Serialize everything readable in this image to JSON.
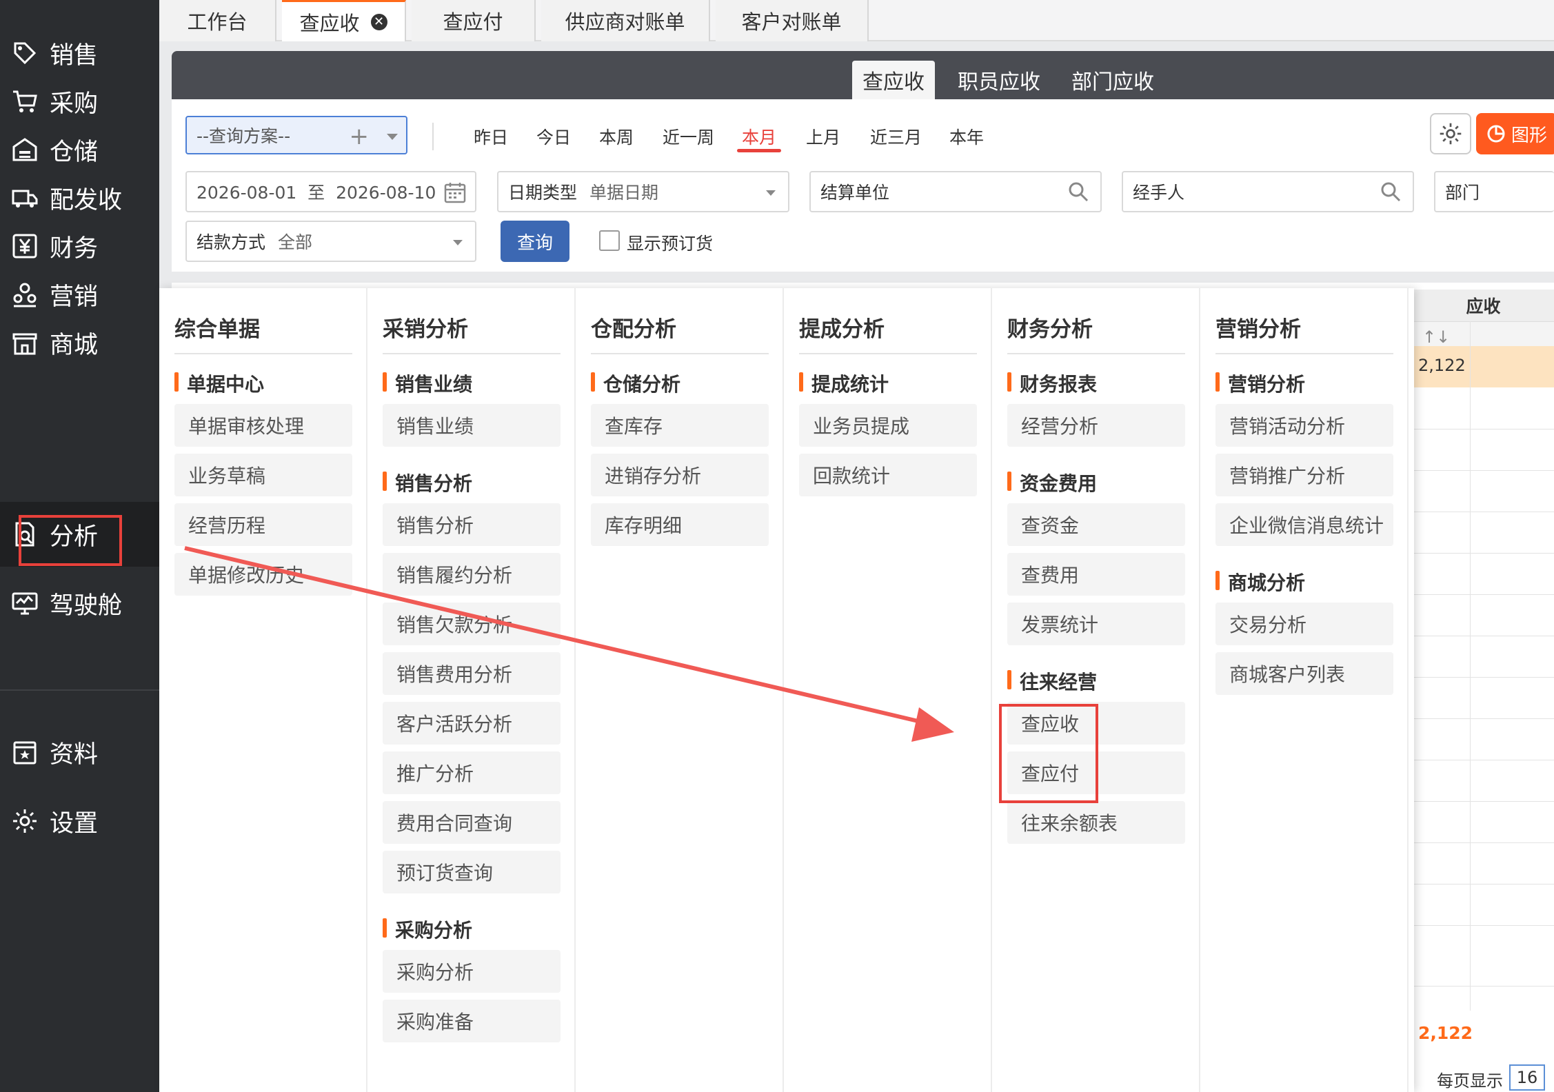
{
  "sidebar": {
    "items": [
      {
        "label": "销售",
        "icon": "tag-icon"
      },
      {
        "label": "采购",
        "icon": "cart-icon"
      },
      {
        "label": "仓储",
        "icon": "warehouse-icon"
      },
      {
        "label": "配发收",
        "icon": "truck-icon"
      },
      {
        "label": "财务",
        "icon": "yen-icon"
      },
      {
        "label": "营销",
        "icon": "people-icon"
      },
      {
        "label": "商城",
        "icon": "store-icon"
      },
      {
        "label": "分析",
        "icon": "analysis-icon"
      },
      {
        "label": "驾驶舱",
        "icon": "monitor-icon"
      },
      {
        "label": "资料",
        "icon": "book-icon"
      },
      {
        "label": "设置",
        "icon": "gear-icon"
      }
    ]
  },
  "tabs": [
    {
      "label": "工作台"
    },
    {
      "label": "查应收",
      "close": "✕"
    },
    {
      "label": "查应付"
    },
    {
      "label": "供应商对账单"
    },
    {
      "label": "客户对账单"
    }
  ],
  "subtabs": [
    {
      "label": "查应收"
    },
    {
      "label": "职员应收"
    },
    {
      "label": "部门应收"
    }
  ],
  "filter": {
    "plan": "--查询方案--",
    "plus": "+",
    "quick_dates": [
      "昨日",
      "今日",
      "本周",
      "近一周",
      "本月",
      "上月",
      "近三月",
      "本年"
    ],
    "chart_label": "图形",
    "date_range": "2026-08-01  至  2026-08-10",
    "date_type_label": "日期类型",
    "date_type_value": "单据日期",
    "settle_unit": "结算单位",
    "handler": "经手人",
    "dept": "部门",
    "pay_method_label": "结款方式",
    "pay_method_value": "全部",
    "query_label": "查询",
    "show_reserved": "显示预订货"
  },
  "table": {
    "group_header": "应收",
    "sort_icon": "↑↓",
    "first_value": "2,122",
    "total": "2,122",
    "page_size_label": "每页显示",
    "page_size": "16"
  },
  "menu": {
    "columns": [
      {
        "title": "综合单据",
        "sections": [
          {
            "name": "单据中心",
            "items": [
              "单据审核处理",
              "业务草稿",
              "经营历程",
              "单据修改历史"
            ]
          }
        ]
      },
      {
        "title": "采销分析",
        "sections": [
          {
            "name": "销售业绩",
            "items": [
              "销售业绩"
            ]
          },
          {
            "name": "销售分析",
            "items": [
              "销售分析",
              "销售履约分析",
              "销售欠款分析",
              "销售费用分析",
              "客户活跃分析",
              "推广分析",
              "费用合同查询",
              "预订货查询"
            ]
          },
          {
            "name": "采购分析",
            "items": [
              "采购分析",
              "采购准备"
            ]
          }
        ]
      },
      {
        "title": "仓配分析",
        "sections": [
          {
            "name": "仓储分析",
            "items": [
              "查库存",
              "进销存分析",
              "库存明细"
            ]
          }
        ]
      },
      {
        "title": "提成分析",
        "sections": [
          {
            "name": "提成统计",
            "items": [
              "业务员提成",
              "回款统计"
            ]
          }
        ]
      },
      {
        "title": "财务分析",
        "sections": [
          {
            "name": "财务报表",
            "items": [
              "经营分析"
            ]
          },
          {
            "name": "资金费用",
            "items": [
              "查资金",
              "查费用",
              "发票统计"
            ]
          },
          {
            "name": "往来经营",
            "items": [
              "查应收",
              "查应付",
              "往来余额表"
            ]
          }
        ]
      },
      {
        "title": "营销分析",
        "sections": [
          {
            "name": "营销分析",
            "items": [
              "营销活动分析",
              "营销推广分析",
              "企业微信消息统计"
            ]
          },
          {
            "name": "商城分析",
            "items": [
              "交易分析",
              "商城客户列表"
            ]
          }
        ]
      }
    ]
  },
  "colors": {
    "accent": "#ff6a1a",
    "highlight": "#e8413b",
    "sidebar_bg": "#2b2d30",
    "primary": "#3c68b3"
  }
}
